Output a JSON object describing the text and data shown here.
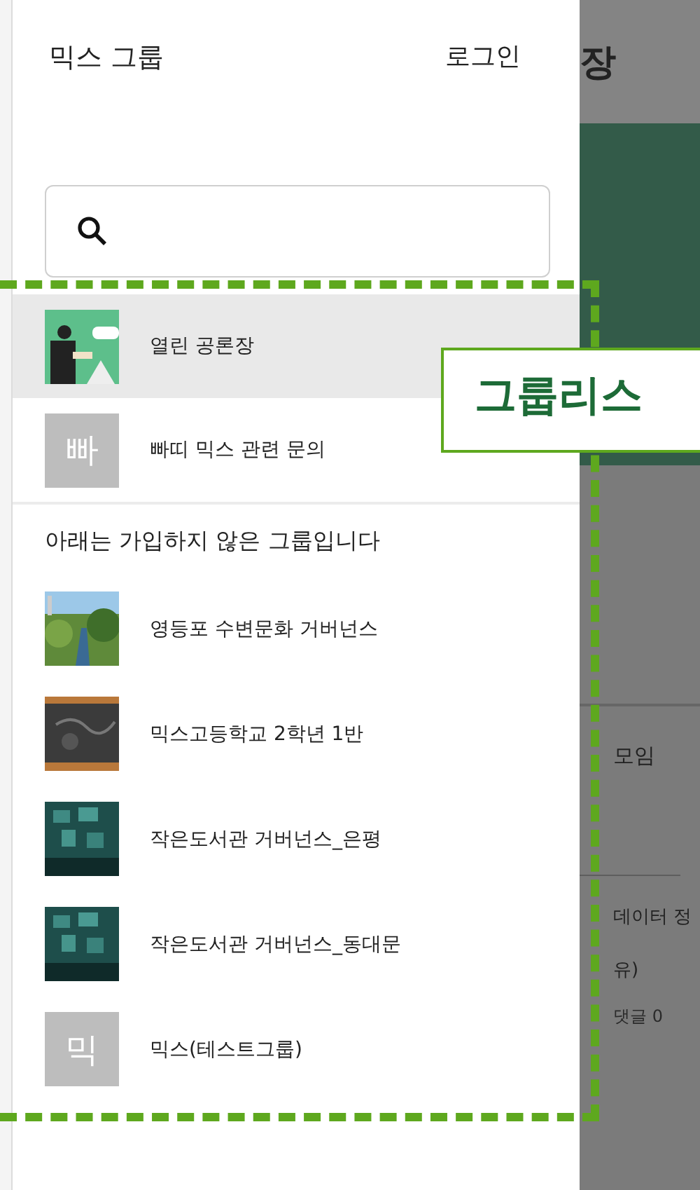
{
  "drawer": {
    "title": "믹스 그룹",
    "login": "로그인",
    "joined": [
      {
        "kind": "picture",
        "name": "열린 공론장",
        "selected": true
      },
      {
        "kind": "letter",
        "letter": "빠",
        "name": "빠띠 믹스 관련 문의",
        "selected": false
      }
    ],
    "section_label": "아래는 가입하지 않은 그룹입니다",
    "unjoined": [
      {
        "kind": "picture",
        "name": "영등포 수변문화 거버넌스",
        "selected": false
      },
      {
        "kind": "picture",
        "name": "믹스고등학교 2학년 1반",
        "selected": false
      },
      {
        "kind": "picture",
        "name": "작은도서관 거버넌스_은평",
        "selected": false
      },
      {
        "kind": "picture",
        "name": "작은도서관 거버넌스_동대문",
        "selected": false
      },
      {
        "kind": "letter",
        "letter": "믹",
        "name": "믹스(테스트그룹)",
        "selected": false
      }
    ]
  },
  "background": {
    "texts": [
      "장",
      "모임",
      "데이터 정",
      "유)",
      "댓글 0"
    ]
  },
  "annotation": {
    "label": "그룹리스"
  }
}
